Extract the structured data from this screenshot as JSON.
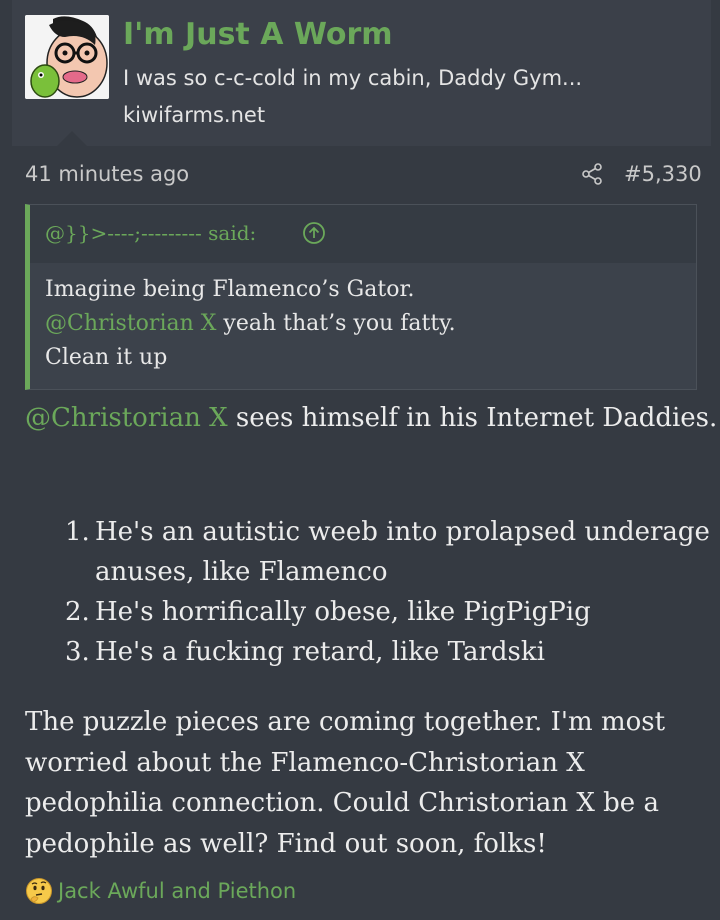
{
  "user": {
    "name": "I'm Just A Worm",
    "title": "I was so c-c-cold in my cabin, Daddy Gym...",
    "site": "kiwifarms.net"
  },
  "post": {
    "time": "41 minutes ago",
    "number": "#5,330"
  },
  "quote": {
    "attribution": "@}}>----;--------- said:",
    "line1": "Imagine being Flamenco’s Gator.",
    "line2_mention": "@Christorian X",
    "line2_rest": " yeah that’s you fatty.",
    "line3": "Clean it up"
  },
  "content": {
    "intro_mention": "@Christorian X",
    "intro_rest": " sees himself in his Internet Daddies.",
    "list": [
      {
        "num": "1.",
        "text": "He's an autistic weeb into prolapsed underage anuses, like Flamenco"
      },
      {
        "num": "2.",
        "text": "He's horrifically obese, like PigPigPig"
      },
      {
        "num": "3.",
        "text": "He's a fucking retard, like Tardski"
      }
    ],
    "conclusion": "The puzzle pieces are coming together. I'm most worried about the Flamenco-Christorian X pedophilia connection. Could Christorian X be a pedophile as well? Find out soon, folks!"
  },
  "reactions": {
    "emoji": "thinking-face-icon",
    "names": "Jack Awful and Piethon"
  },
  "colors": {
    "background": "#353a42",
    "header": "#3b4049",
    "accent": "#6ba85a",
    "text": "#ececec"
  }
}
